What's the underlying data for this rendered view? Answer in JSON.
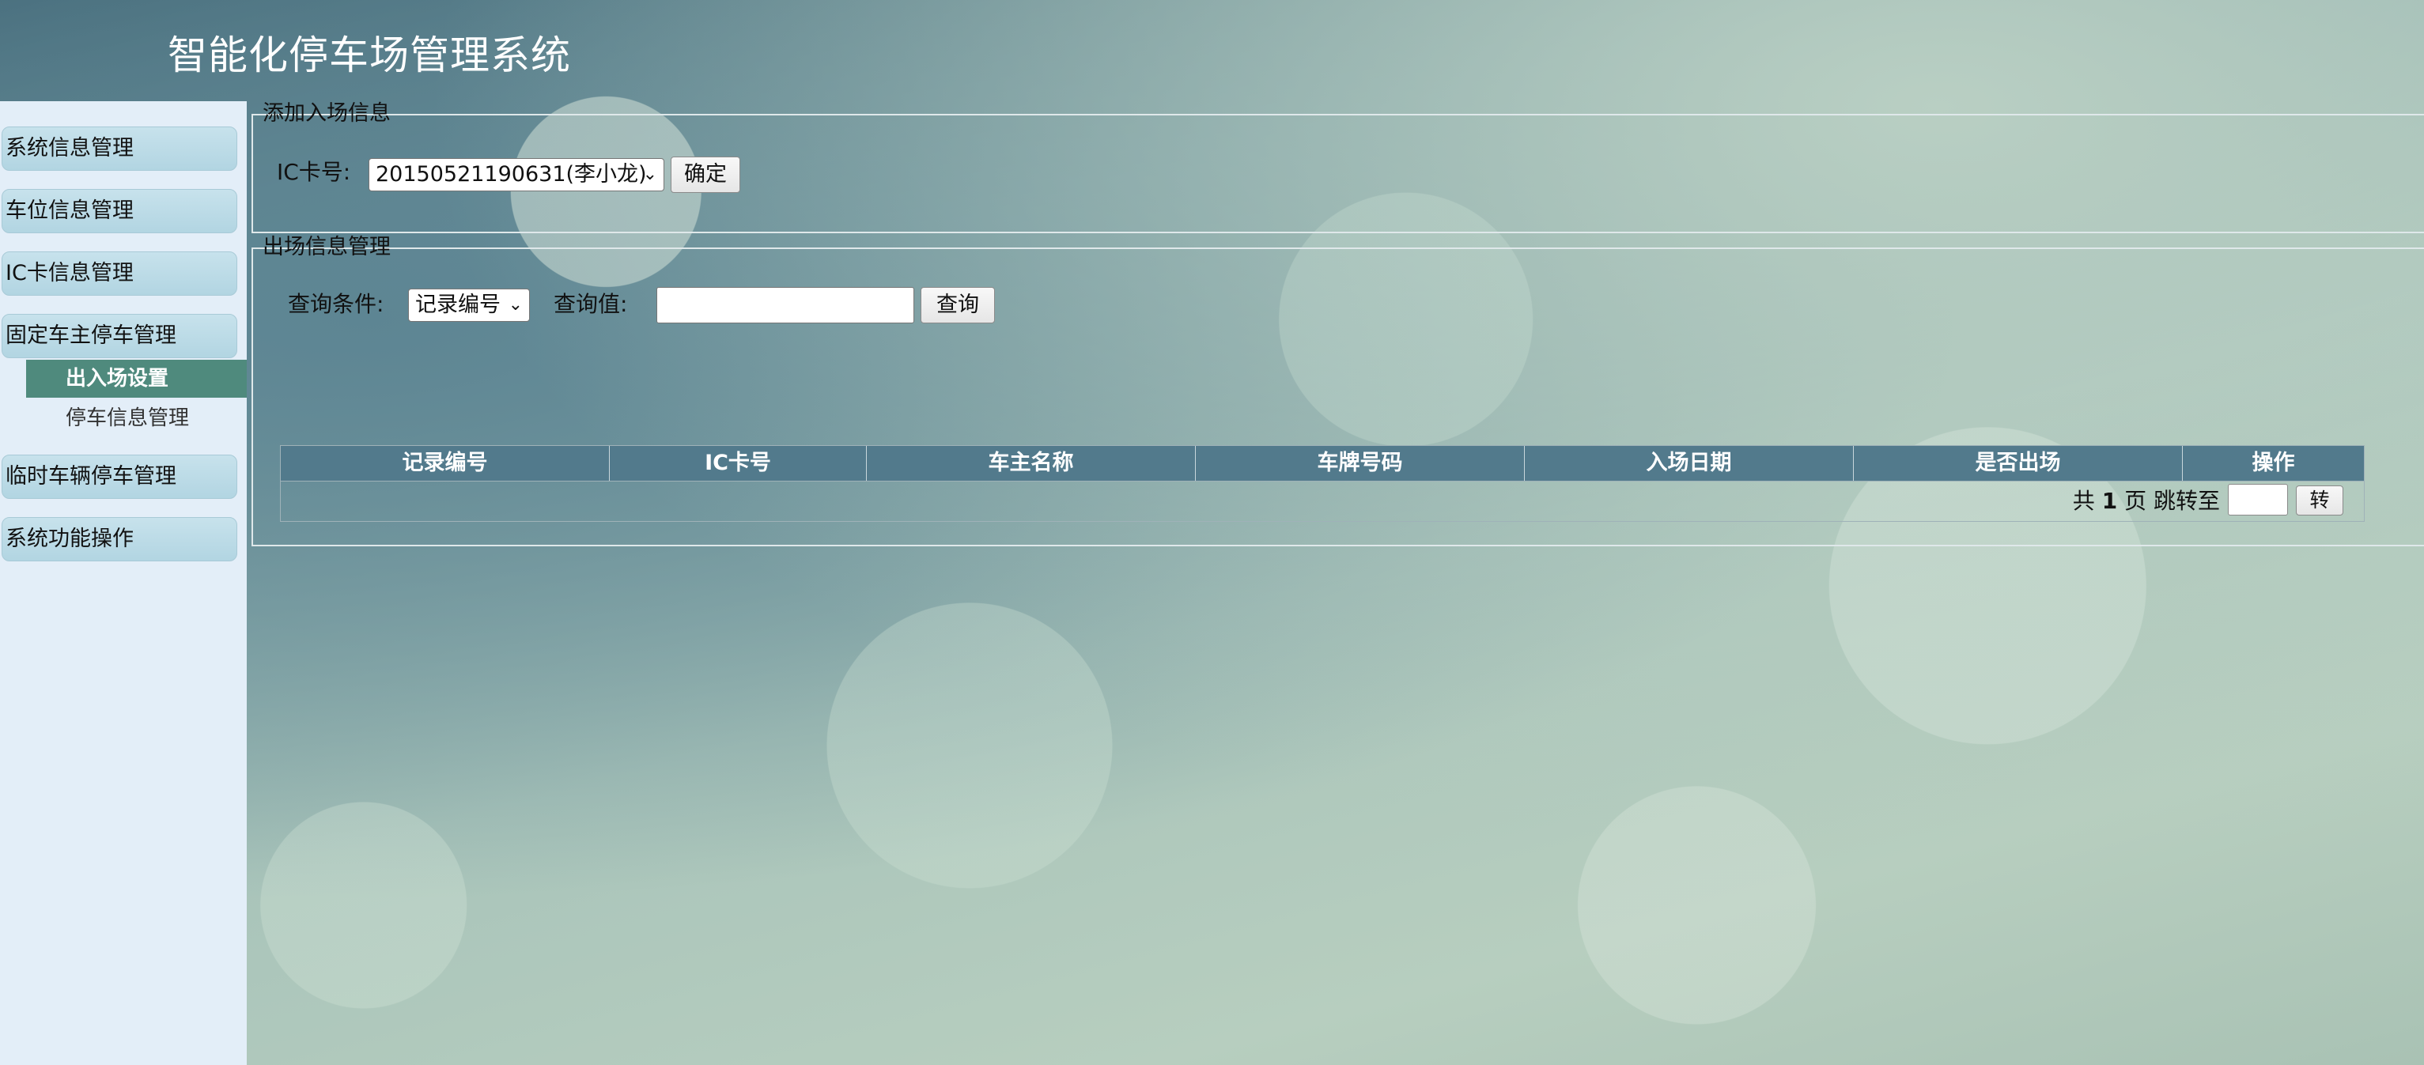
{
  "app": {
    "title": "智能化停车场管理系统"
  },
  "sidebar": {
    "items": [
      {
        "label": "系统信息管理"
      },
      {
        "label": "车位信息管理"
      },
      {
        "label": "IC卡信息管理"
      },
      {
        "label": "固定车主停车管理"
      },
      {
        "label": "临时车辆停车管理"
      },
      {
        "label": "系统功能操作"
      }
    ],
    "sub_items": [
      {
        "label": "出入场设置",
        "active": true
      },
      {
        "label": "停车信息管理",
        "active": false
      }
    ]
  },
  "entry": {
    "legend": "添加入场信息",
    "ic_label": "IC卡号:",
    "ic_selected": "20150521190631(李小龙)",
    "confirm_label": "确定"
  },
  "exit": {
    "legend": "出场信息管理",
    "condition_label": "查询条件:",
    "condition_selected": "记录编号",
    "value_label": "查询值:",
    "value_input": "",
    "query_label": "查询",
    "columns": [
      "记录编号",
      "IC卡号",
      "车主名称",
      "车牌号码",
      "入场日期",
      "是否出场",
      "操作"
    ],
    "rows": [],
    "pager": {
      "prefix": "共",
      "total_pages": "1",
      "suffix": "页 跳转至",
      "goto_value": "",
      "goto_label": "转"
    }
  },
  "colors": {
    "sidebar_bg": "#e3eef8",
    "menu_bg": "#b2d5e2",
    "active_sub": "#4f8a7d",
    "table_header": "#527a8c"
  }
}
